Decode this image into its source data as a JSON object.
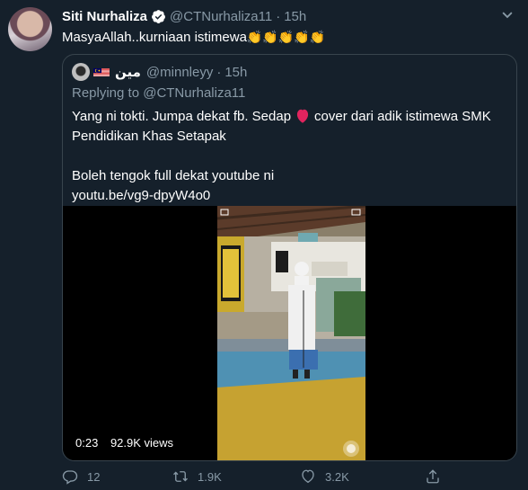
{
  "tweet": {
    "author_name": "Siti Nurhaliza",
    "author_handle": "@CTNurhaliza11",
    "separator": "·",
    "time": "15h",
    "text": "MasyaAllah..kurniaan istimewa",
    "emoji": "👏👏👏👏👏"
  },
  "quoted": {
    "author_name": "مين",
    "author_handle": "@minnleyy",
    "separator": "·",
    "time": "15h",
    "replying_to": "Replying to @CTNurhaliza11",
    "line1_a": "Yang ni tokti. Jumpa dekat fb. Sedap",
    "line1_b": "cover dari adik istimewa SMK",
    "line2": "Pendidikan Khas Setapak",
    "line3": "Boleh tengok full dekat youtube ni",
    "link": "youtu.be/vg9-dpyW4o0",
    "video": {
      "duration": "0:23",
      "views": "92.9K views"
    }
  },
  "actions": {
    "reply_count": "12",
    "retweet_count": "1.9K",
    "like_count": "3.2K"
  },
  "colors": {
    "background": "#15202b",
    "secondary_text": "#8899a6",
    "border": "#38444d",
    "verified": "#ffffff",
    "heart": "#e0245e"
  }
}
